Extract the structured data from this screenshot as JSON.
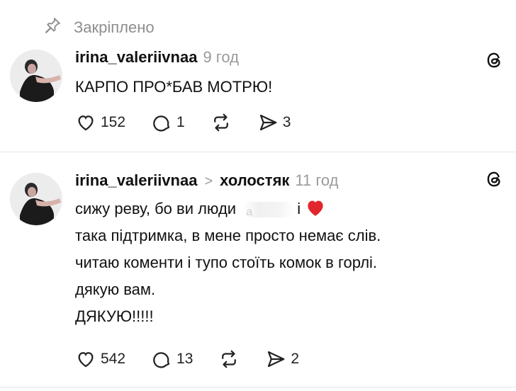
{
  "pinned": {
    "label": "Закріплено",
    "icon": "pin-icon"
  },
  "posts": [
    {
      "username": "irina_valeriivnaa",
      "time": "9 год",
      "lines": [
        "КАРПО ПРО*БАВ МОТРЮ!"
      ],
      "likes": "152",
      "replies": "1",
      "reposts": "",
      "shares": "3"
    },
    {
      "username": "irina_valeriivnaa",
      "topic_sep": ">",
      "topic": "холостяк",
      "time": "11 год",
      "line1_before": "сижу реву, бо ви люди",
      "line1_blur": "а",
      "line1_after": "і",
      "lines": [
        "така підтримка, в мене просто немає слів.",
        "читаю коменти і тупо стоїть комок в горлі.",
        "дякую вам.",
        "ДЯКУЮ!!!!!"
      ],
      "likes": "542",
      "replies": "13",
      "reposts": "",
      "shares": "2"
    }
  ],
  "colors": {
    "text": "#111111",
    "muted": "#9a9a9a",
    "heart": "#e0262c",
    "divider": "#e6e6e6"
  }
}
